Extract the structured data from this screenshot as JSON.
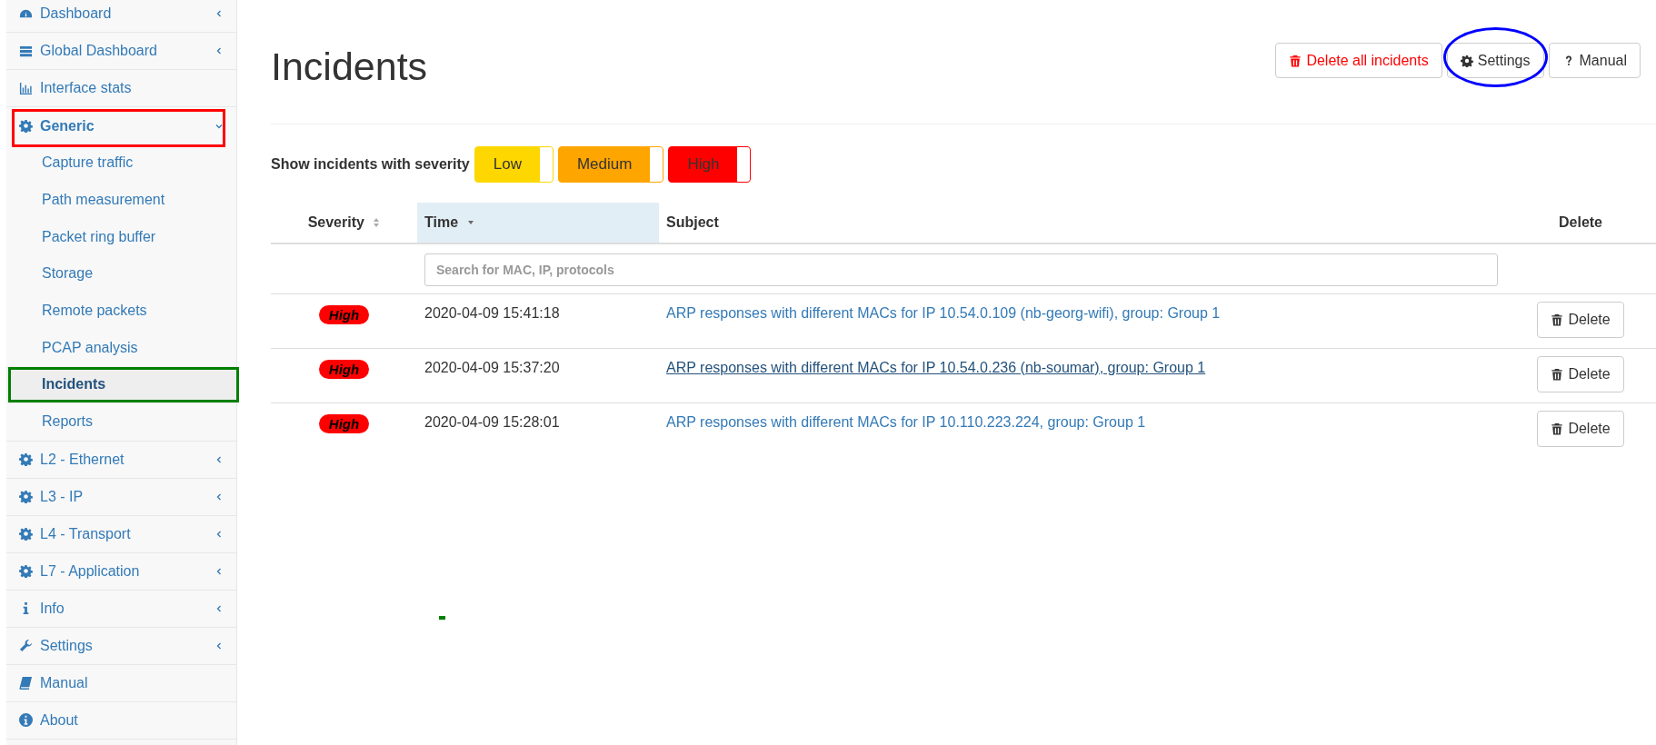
{
  "sidebar": {
    "items": [
      {
        "label": "Dashboard",
        "kind": "gauge",
        "expanded": false,
        "annotated": false
      },
      {
        "label": "Global Dashboard",
        "kind": "servers",
        "expanded": false,
        "annotated": false
      },
      {
        "label": "Interface stats",
        "kind": "barchart",
        "annotated": false
      },
      {
        "label": "Generic",
        "kind": "gear",
        "expanded": true,
        "annotated": true,
        "color": "#ff0000",
        "children": [
          {
            "label": "Capture traffic",
            "selected": false,
            "annotated": false
          },
          {
            "label": "Path measurement",
            "selected": false,
            "annotated": false
          },
          {
            "label": "Packet ring buffer",
            "selected": false,
            "annotated": false
          },
          {
            "label": "Storage",
            "selected": false,
            "annotated": false
          },
          {
            "label": "Remote packets",
            "selected": false,
            "annotated": false
          },
          {
            "label": "PCAP analysis",
            "selected": false,
            "annotated": false
          },
          {
            "label": "Incidents",
            "selected": true,
            "annotated": true,
            "color": "#008000"
          },
          {
            "label": "Reports",
            "selected": false,
            "annotated": false
          }
        ]
      },
      {
        "label": "L2 - Ethernet",
        "kind": "gear",
        "expanded": false,
        "annotated": false
      },
      {
        "label": "L3 - IP",
        "kind": "gear",
        "expanded": false,
        "annotated": false
      },
      {
        "label": "L4 - Transport",
        "kind": "gear",
        "expanded": false,
        "annotated": false
      },
      {
        "label": "L7 - Application",
        "kind": "gear",
        "expanded": false,
        "annotated": false
      },
      {
        "label": "Info",
        "kind": "info",
        "expanded": false,
        "annotated": false
      },
      {
        "label": "Settings",
        "kind": "wrench",
        "expanded": false,
        "annotated": false
      },
      {
        "label": "Manual",
        "kind": "book",
        "annotated": false
      },
      {
        "label": "About",
        "kind": "about",
        "annotated": false
      }
    ]
  },
  "page": {
    "title": "Incidents",
    "actions": [
      {
        "label": "Delete all incidents",
        "kind": "delete",
        "annotated": false
      },
      {
        "label": "Settings",
        "kind": "settings",
        "annotated": true,
        "color": "#0000ff"
      },
      {
        "label": "Manual",
        "kind": "help",
        "annotated": false
      }
    ]
  },
  "severity_filter": {
    "label": "Show incidents with severity",
    "toggles": [
      {
        "label": "Low",
        "checked": true,
        "color": "#ffd700"
      },
      {
        "label": "Medium",
        "checked": true,
        "color": "#ffa500"
      },
      {
        "label": "High",
        "checked": true,
        "color": "#ff0000"
      }
    ]
  },
  "table": {
    "columns": [
      {
        "label": "Severity",
        "sortable": true,
        "sorted": false
      },
      {
        "label": "Time",
        "sortable": true,
        "sorted": true
      },
      {
        "label": "Subject",
        "sortable": false,
        "sorted": false
      },
      {
        "label": "Delete",
        "sortable": false,
        "sorted": false
      }
    ],
    "search": {
      "placeholder": "Search for MAC, IP, protocols"
    },
    "rows": [
      {
        "severity": "High",
        "time": "2020-04-09 15:41:18",
        "subject": "ARP responses with different MACs for IP 10.54.0.109 (nb-georg-wifi), group: Group 1",
        "hovered": false,
        "action": "Delete"
      },
      {
        "severity": "High",
        "time": "2020-04-09 15:37:20",
        "subject": "ARP responses with different MACs for IP 10.54.0.236 (nb-soumar), group: Group 1",
        "hovered": true,
        "action": "Delete"
      },
      {
        "severity": "High",
        "time": "2020-04-09 15:28:01",
        "subject": "ARP responses with different MACs for IP 10.110.223.224, group: Group 1",
        "hovered": false,
        "action": "Delete"
      }
    ]
  }
}
